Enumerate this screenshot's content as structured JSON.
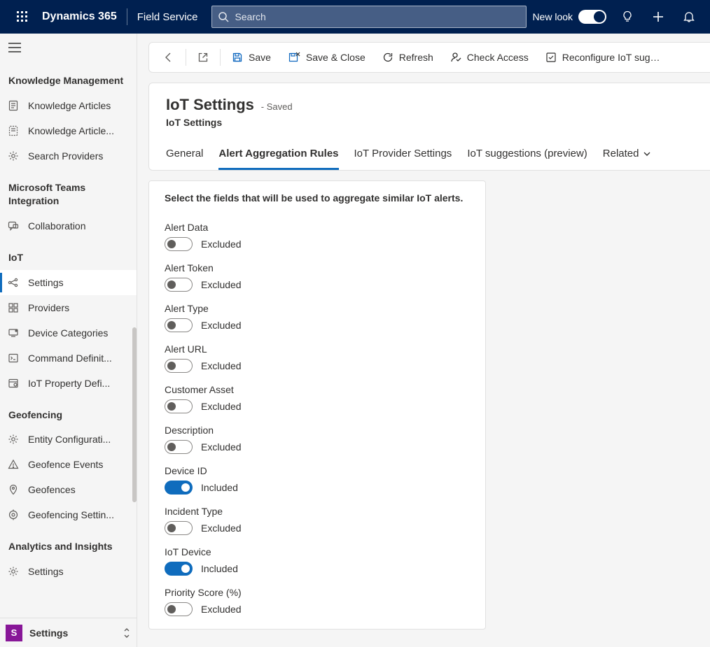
{
  "navbar": {
    "product": "Dynamics 365",
    "module": "Field Service",
    "search_placeholder": "Search",
    "newlook_label": "New look"
  },
  "sidebar": {
    "groups": [
      {
        "title": "Knowledge Management",
        "items": [
          {
            "label": "Knowledge Articles"
          },
          {
            "label": "Knowledge Article..."
          },
          {
            "label": "Search Providers"
          }
        ]
      },
      {
        "title": "Microsoft Teams Integration",
        "items": [
          {
            "label": "Collaboration"
          }
        ]
      },
      {
        "title": "IoT",
        "items": [
          {
            "label": "Settings",
            "active": true
          },
          {
            "label": "Providers"
          },
          {
            "label": "Device Categories"
          },
          {
            "label": "Command Definit..."
          },
          {
            "label": "IoT Property Defi..."
          }
        ]
      },
      {
        "title": "Geofencing",
        "items": [
          {
            "label": "Entity Configurati..."
          },
          {
            "label": "Geofence Events"
          },
          {
            "label": "Geofences"
          },
          {
            "label": "Geofencing Settin..."
          }
        ]
      },
      {
        "title": "Analytics and Insights",
        "items": [
          {
            "label": "Settings"
          }
        ]
      }
    ],
    "area_switch": {
      "badge": "S",
      "label": "Settings"
    }
  },
  "commandbar": {
    "save": "Save",
    "saveclose": "Save & Close",
    "refresh": "Refresh",
    "checkaccess": "Check Access",
    "reconfigure": "Reconfigure IoT sugge..."
  },
  "formheader": {
    "title": "IoT Settings",
    "status": "- Saved",
    "subtitle": "IoT Settings",
    "tabs": {
      "general": "General",
      "aggregation": "Alert Aggregation Rules",
      "provider": "IoT Provider Settings",
      "suggestions": "IoT suggestions (preview)",
      "related": "Related"
    }
  },
  "panel": {
    "heading": "Select the fields that will be used to aggregate similar IoT alerts.",
    "on_label": "Included",
    "off_label": "Excluded",
    "fields": {
      "alert_data": "Alert Data",
      "alert_token": "Alert Token",
      "alert_type": "Alert Type",
      "alert_url": "Alert URL",
      "customer_asset": "Customer Asset",
      "description": "Description",
      "device_id": "Device ID",
      "incident_type": "Incident Type",
      "iot_device": "IoT Device",
      "priority_score": "Priority Score (%)"
    }
  }
}
